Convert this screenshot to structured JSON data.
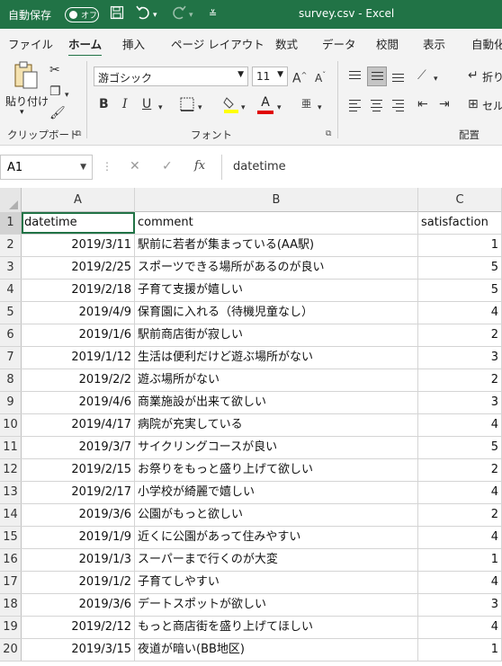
{
  "titlebar": {
    "autosave_label": "自動保存",
    "toggle_state": "オフ",
    "title": "survey.csv - Excel"
  },
  "menu": {
    "tabs": [
      "ファイル",
      "ホーム",
      "挿入",
      "ページ レイアウト",
      "数式",
      "データ",
      "校閲",
      "表示",
      "自動化"
    ],
    "active": "ホーム"
  },
  "ribbon": {
    "paste_label": "貼り付け",
    "clipboard_label": "クリップボード",
    "font_name": "游ゴシック",
    "font_size": "11",
    "font_label": "フォント",
    "bold": "B",
    "italic": "I",
    "underline": "U",
    "grow_font": "A",
    "shrink_font": "A",
    "font_color_glyph": "A",
    "wrap_label": "折り",
    "merge_label": "セル",
    "align_label": "配置",
    "phonetic": "亜"
  },
  "formula_bar": {
    "cell_ref": "A1",
    "fx": "fx",
    "content": "datetime"
  },
  "grid": {
    "column_headers": [
      "A",
      "B",
      "C"
    ],
    "rows": [
      {
        "n": "1",
        "a": "datetime",
        "b": "comment",
        "c": "satisfaction"
      },
      {
        "n": "2",
        "a": "2019/3/11",
        "b": "駅前に若者が集まっている(AA駅)",
        "c": "1"
      },
      {
        "n": "3",
        "a": "2019/2/25",
        "b": "スポーツできる場所があるのが良い",
        "c": "5"
      },
      {
        "n": "4",
        "a": "2019/2/18",
        "b": "子育て支援が嬉しい",
        "c": "5"
      },
      {
        "n": "5",
        "a": "2019/4/9",
        "b": "保育園に入れる（待機児童なし）",
        "c": "4"
      },
      {
        "n": "6",
        "a": "2019/1/6",
        "b": "駅前商店街が寂しい",
        "c": "2"
      },
      {
        "n": "7",
        "a": "2019/1/12",
        "b": "生活は便利だけど遊ぶ場所がない",
        "c": "3"
      },
      {
        "n": "8",
        "a": "2019/2/2",
        "b": "遊ぶ場所がない",
        "c": "2"
      },
      {
        "n": "9",
        "a": "2019/4/6",
        "b": "商業施設が出来て欲しい",
        "c": "3"
      },
      {
        "n": "10",
        "a": "2019/4/17",
        "b": "病院が充実している",
        "c": "4"
      },
      {
        "n": "11",
        "a": "2019/3/7",
        "b": "サイクリングコースが良い",
        "c": "5"
      },
      {
        "n": "12",
        "a": "2019/2/15",
        "b": "お祭りをもっと盛り上げて欲しい",
        "c": "2"
      },
      {
        "n": "13",
        "a": "2019/2/17",
        "b": "小学校が綺麗で嬉しい",
        "c": "4"
      },
      {
        "n": "14",
        "a": "2019/3/6",
        "b": "公園がもっと欲しい",
        "c": "2"
      },
      {
        "n": "15",
        "a": "2019/1/9",
        "b": "近くに公園があって住みやすい",
        "c": "4"
      },
      {
        "n": "16",
        "a": "2019/1/3",
        "b": "スーパーまで行くのが大変",
        "c": "1"
      },
      {
        "n": "17",
        "a": "2019/1/2",
        "b": "子育てしやすい",
        "c": "4"
      },
      {
        "n": "18",
        "a": "2019/3/6",
        "b": "デートスポットが欲しい",
        "c": "3"
      },
      {
        "n": "19",
        "a": "2019/2/12",
        "b": "もっと商店街を盛り上げてほしい",
        "c": "4"
      },
      {
        "n": "20",
        "a": "2019/3/15",
        "b": "夜道が暗い(BB地区)",
        "c": "1"
      }
    ]
  },
  "colors": {
    "excel_green": "#217346",
    "highlight_yellow": "#ffff00",
    "font_red": "#e00000"
  },
  "icons": [
    "save-icon",
    "undo-icon",
    "redo-icon",
    "customize-qat-icon",
    "paste-icon",
    "cut-icon",
    "copy-icon",
    "format-painter-icon",
    "grow-font-icon",
    "shrink-font-icon",
    "borders-icon",
    "fill-color-icon",
    "font-color-icon",
    "phonetic-icon",
    "align-top-icon",
    "align-middle-icon",
    "align-bottom-icon",
    "orientation-icon",
    "align-left-icon",
    "align-center-icon",
    "align-right-icon",
    "decrease-indent-icon",
    "increase-indent-icon",
    "wrap-text-icon",
    "merge-icon",
    "cancel-icon",
    "enter-icon",
    "insert-function-icon"
  ]
}
